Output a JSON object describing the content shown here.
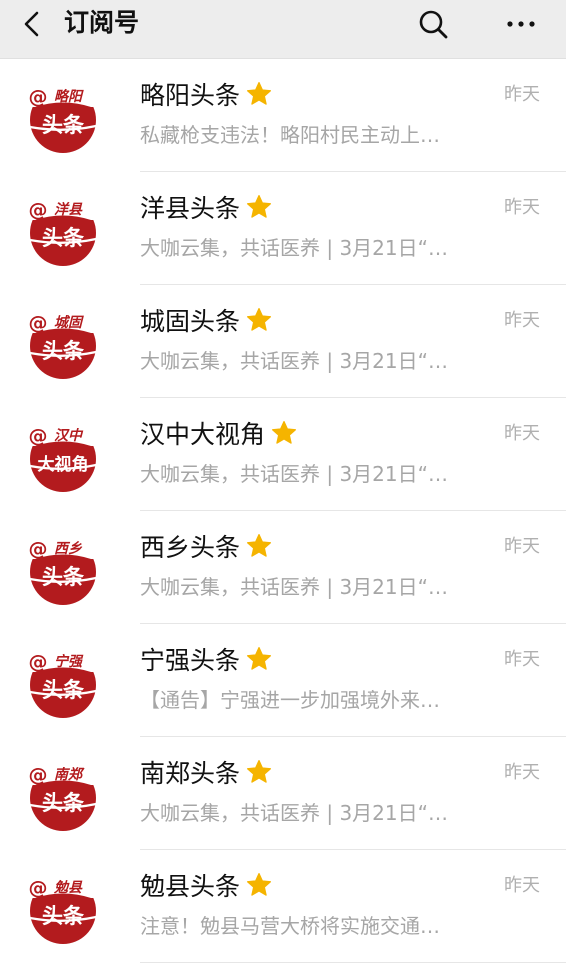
{
  "header": {
    "title": "订阅号",
    "back_icon": "chevron-left-icon",
    "search_icon": "search-icon",
    "more_icon": "more-dots-icon",
    "background": "#ededed"
  },
  "accounts": [
    {
      "name": "略阳头条",
      "logo_city": "略阳",
      "logo_main": "头条",
      "summary": "私藏枪支违法！略阳村民主动上…",
      "time": "昨天",
      "starred": true
    },
    {
      "name": "洋县头条",
      "logo_city": "洋县",
      "logo_main": "头条",
      "summary": "大咖云集，共话医养 | 3月21日“…",
      "time": "昨天",
      "starred": true
    },
    {
      "name": "城固头条",
      "logo_city": "城固",
      "logo_main": "头条",
      "summary": "大咖云集，共话医养 | 3月21日“…",
      "time": "昨天",
      "starred": true
    },
    {
      "name": "汉中大视角",
      "logo_city": "汉中",
      "logo_main": "大视角",
      "summary": "大咖云集，共话医养 | 3月21日“…",
      "time": "昨天",
      "starred": true
    },
    {
      "name": "西乡头条",
      "logo_city": "西乡",
      "logo_main": "头条",
      "summary": "大咖云集，共话医养 | 3月21日“…",
      "time": "昨天",
      "starred": true
    },
    {
      "name": "宁强头条",
      "logo_city": "宁强",
      "logo_main": "头条",
      "summary": "【通告】宁强进一步加强境外来…",
      "time": "昨天",
      "starred": true
    },
    {
      "name": "南郑头条",
      "logo_city": "南郑",
      "logo_main": "头条",
      "summary": "大咖云集，共话医养 | 3月21日“…",
      "time": "昨天",
      "starred": true
    },
    {
      "name": "勉县头条",
      "logo_city": "勉县",
      "logo_main": "头条",
      "summary": "注意！勉县马营大桥将实施交通…",
      "time": "昨天",
      "starred": true
    }
  ],
  "colors": {
    "logo_red": "#b31b1e",
    "star": "#f5b400",
    "summary": "#a6a6a6",
    "time": "#b0b0b0"
  }
}
